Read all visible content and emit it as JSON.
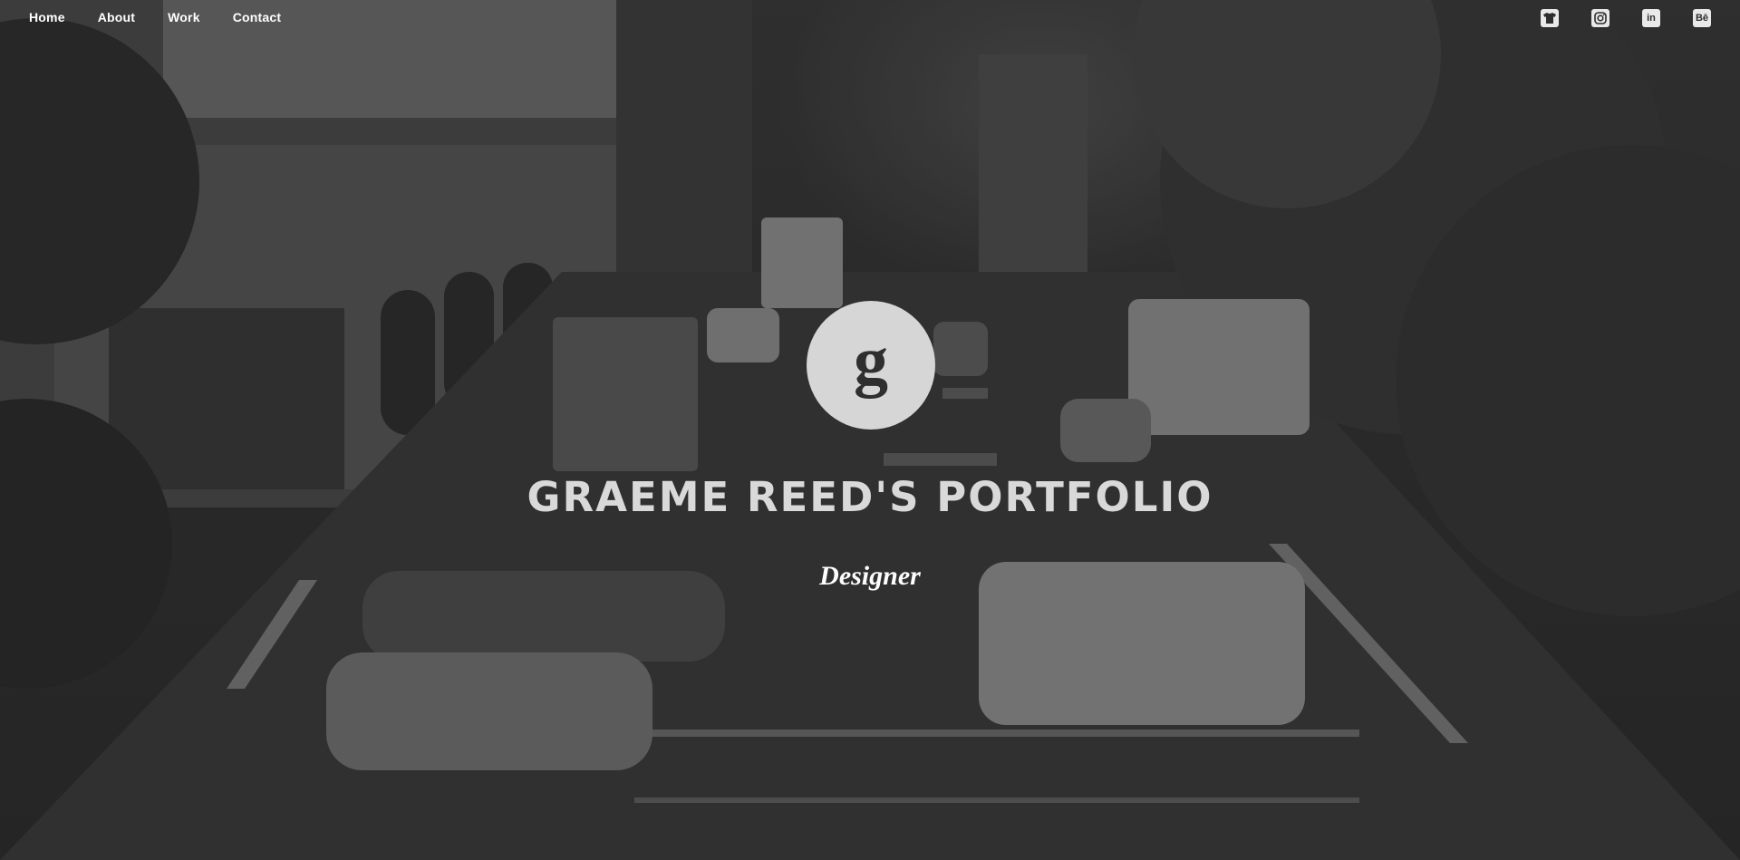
{
  "nav": {
    "items": [
      {
        "label": "Home"
      },
      {
        "label": "About"
      },
      {
        "label": "Work"
      },
      {
        "label": "Contact"
      }
    ]
  },
  "social": {
    "items": [
      {
        "icon": "tshirt-icon",
        "label": ""
      },
      {
        "icon": "instagram-icon",
        "label": ""
      },
      {
        "icon": "linkedin-icon",
        "label": "in"
      },
      {
        "icon": "behance-icon",
        "label": "Bē"
      }
    ]
  },
  "hero": {
    "logo_letter": "g",
    "title": "GRAEME REED'S PORTFOLIO",
    "subtitle": "Designer"
  },
  "colors": {
    "overlay": "#2b2b2b",
    "logo_circle": "#d6d6d6",
    "title": "#d9d9d9",
    "subtitle": "#ffffff"
  }
}
